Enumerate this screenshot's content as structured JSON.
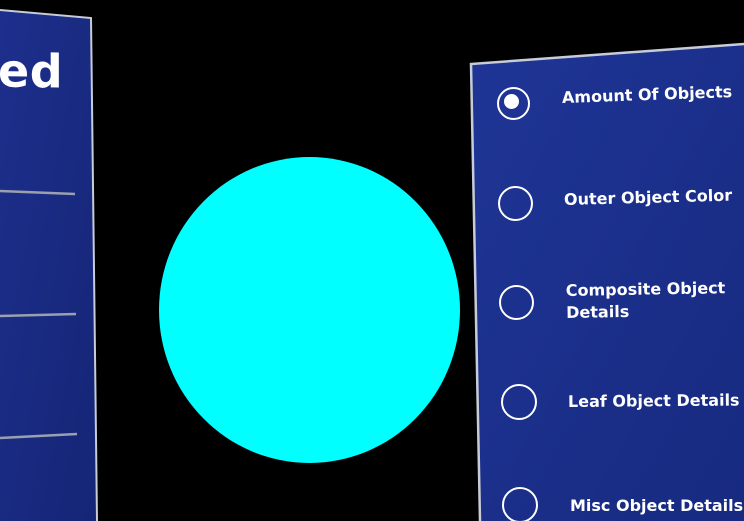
{
  "left_panel": {
    "title_fragment": "ed"
  },
  "sphere": {
    "color": "#00ffff"
  },
  "menu": {
    "panel_color": "#1a2f8f",
    "items": [
      {
        "label": "Amount Of Objects",
        "selected": true
      },
      {
        "label": "Outer Object Color",
        "selected": false
      },
      {
        "label": "Composite Object Details",
        "selected": false
      },
      {
        "label": "Leaf Object Details",
        "selected": false
      },
      {
        "label": "Misc Object Details",
        "selected": false
      }
    ]
  }
}
